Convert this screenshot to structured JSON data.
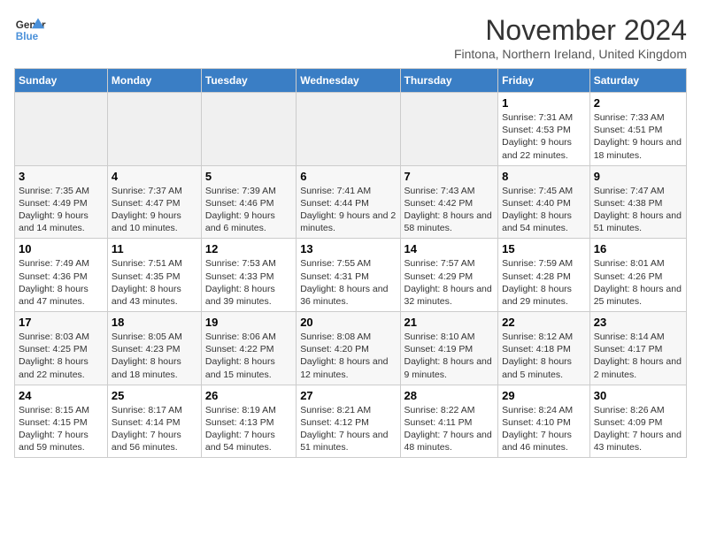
{
  "logo": {
    "line1": "General",
    "line2": "Blue"
  },
  "title": "November 2024",
  "location": "Fintona, Northern Ireland, United Kingdom",
  "days_of_week": [
    "Sunday",
    "Monday",
    "Tuesday",
    "Wednesday",
    "Thursday",
    "Friday",
    "Saturday"
  ],
  "weeks": [
    [
      {
        "day": "",
        "info": ""
      },
      {
        "day": "",
        "info": ""
      },
      {
        "day": "",
        "info": ""
      },
      {
        "day": "",
        "info": ""
      },
      {
        "day": "",
        "info": ""
      },
      {
        "day": "1",
        "info": "Sunrise: 7:31 AM\nSunset: 4:53 PM\nDaylight: 9 hours and 22 minutes."
      },
      {
        "day": "2",
        "info": "Sunrise: 7:33 AM\nSunset: 4:51 PM\nDaylight: 9 hours and 18 minutes."
      }
    ],
    [
      {
        "day": "3",
        "info": "Sunrise: 7:35 AM\nSunset: 4:49 PM\nDaylight: 9 hours and 14 minutes."
      },
      {
        "day": "4",
        "info": "Sunrise: 7:37 AM\nSunset: 4:47 PM\nDaylight: 9 hours and 10 minutes."
      },
      {
        "day": "5",
        "info": "Sunrise: 7:39 AM\nSunset: 4:46 PM\nDaylight: 9 hours and 6 minutes."
      },
      {
        "day": "6",
        "info": "Sunrise: 7:41 AM\nSunset: 4:44 PM\nDaylight: 9 hours and 2 minutes."
      },
      {
        "day": "7",
        "info": "Sunrise: 7:43 AM\nSunset: 4:42 PM\nDaylight: 8 hours and 58 minutes."
      },
      {
        "day": "8",
        "info": "Sunrise: 7:45 AM\nSunset: 4:40 PM\nDaylight: 8 hours and 54 minutes."
      },
      {
        "day": "9",
        "info": "Sunrise: 7:47 AM\nSunset: 4:38 PM\nDaylight: 8 hours and 51 minutes."
      }
    ],
    [
      {
        "day": "10",
        "info": "Sunrise: 7:49 AM\nSunset: 4:36 PM\nDaylight: 8 hours and 47 minutes."
      },
      {
        "day": "11",
        "info": "Sunrise: 7:51 AM\nSunset: 4:35 PM\nDaylight: 8 hours and 43 minutes."
      },
      {
        "day": "12",
        "info": "Sunrise: 7:53 AM\nSunset: 4:33 PM\nDaylight: 8 hours and 39 minutes."
      },
      {
        "day": "13",
        "info": "Sunrise: 7:55 AM\nSunset: 4:31 PM\nDaylight: 8 hours and 36 minutes."
      },
      {
        "day": "14",
        "info": "Sunrise: 7:57 AM\nSunset: 4:29 PM\nDaylight: 8 hours and 32 minutes."
      },
      {
        "day": "15",
        "info": "Sunrise: 7:59 AM\nSunset: 4:28 PM\nDaylight: 8 hours and 29 minutes."
      },
      {
        "day": "16",
        "info": "Sunrise: 8:01 AM\nSunset: 4:26 PM\nDaylight: 8 hours and 25 minutes."
      }
    ],
    [
      {
        "day": "17",
        "info": "Sunrise: 8:03 AM\nSunset: 4:25 PM\nDaylight: 8 hours and 22 minutes."
      },
      {
        "day": "18",
        "info": "Sunrise: 8:05 AM\nSunset: 4:23 PM\nDaylight: 8 hours and 18 minutes."
      },
      {
        "day": "19",
        "info": "Sunrise: 8:06 AM\nSunset: 4:22 PM\nDaylight: 8 hours and 15 minutes."
      },
      {
        "day": "20",
        "info": "Sunrise: 8:08 AM\nSunset: 4:20 PM\nDaylight: 8 hours and 12 minutes."
      },
      {
        "day": "21",
        "info": "Sunrise: 8:10 AM\nSunset: 4:19 PM\nDaylight: 8 hours and 9 minutes."
      },
      {
        "day": "22",
        "info": "Sunrise: 8:12 AM\nSunset: 4:18 PM\nDaylight: 8 hours and 5 minutes."
      },
      {
        "day": "23",
        "info": "Sunrise: 8:14 AM\nSunset: 4:17 PM\nDaylight: 8 hours and 2 minutes."
      }
    ],
    [
      {
        "day": "24",
        "info": "Sunrise: 8:15 AM\nSunset: 4:15 PM\nDaylight: 7 hours and 59 minutes."
      },
      {
        "day": "25",
        "info": "Sunrise: 8:17 AM\nSunset: 4:14 PM\nDaylight: 7 hours and 56 minutes."
      },
      {
        "day": "26",
        "info": "Sunrise: 8:19 AM\nSunset: 4:13 PM\nDaylight: 7 hours and 54 minutes."
      },
      {
        "day": "27",
        "info": "Sunrise: 8:21 AM\nSunset: 4:12 PM\nDaylight: 7 hours and 51 minutes."
      },
      {
        "day": "28",
        "info": "Sunrise: 8:22 AM\nSunset: 4:11 PM\nDaylight: 7 hours and 48 minutes."
      },
      {
        "day": "29",
        "info": "Sunrise: 8:24 AM\nSunset: 4:10 PM\nDaylight: 7 hours and 46 minutes."
      },
      {
        "day": "30",
        "info": "Sunrise: 8:26 AM\nSunset: 4:09 PM\nDaylight: 7 hours and 43 minutes."
      }
    ]
  ]
}
